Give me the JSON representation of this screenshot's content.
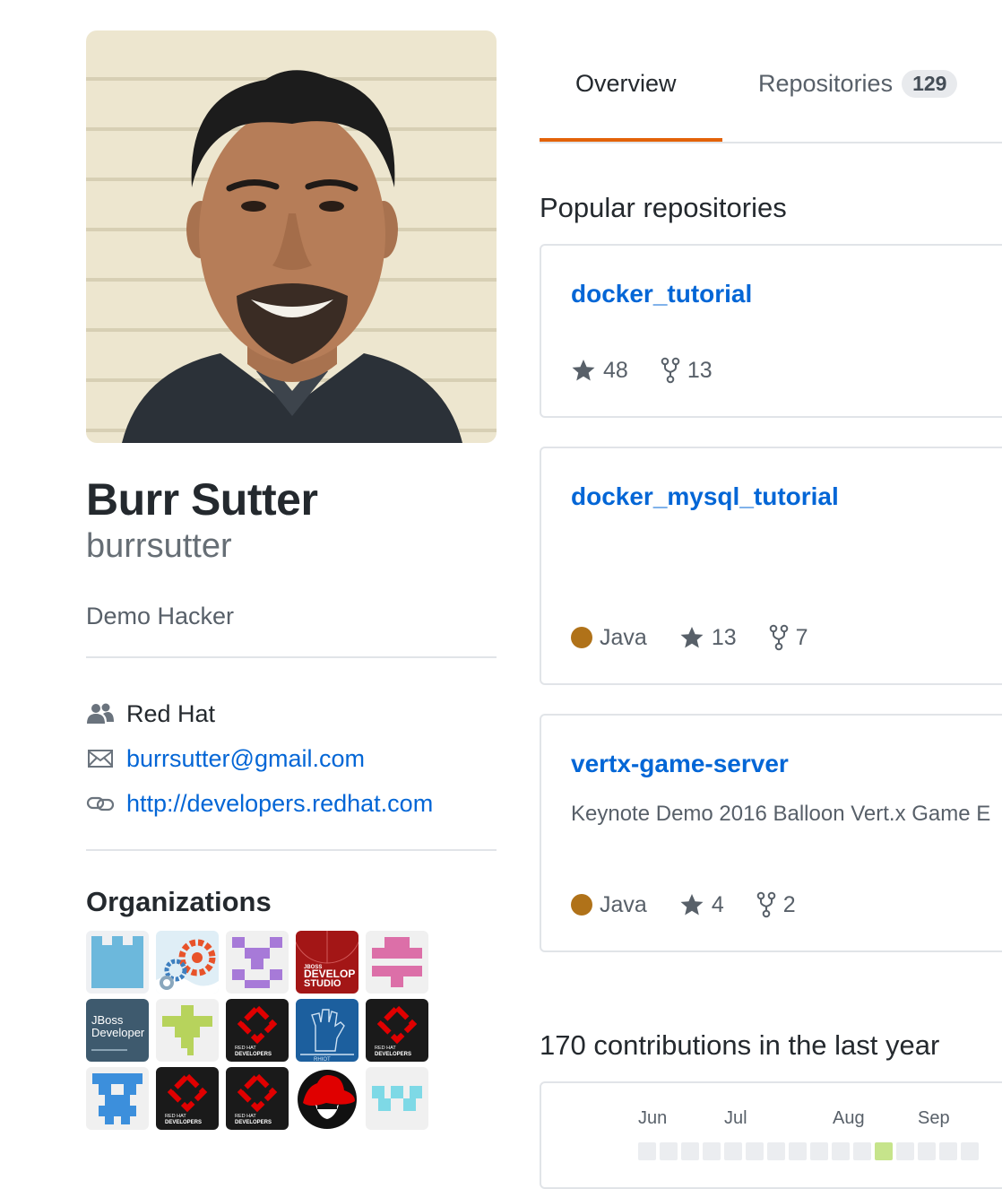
{
  "profile": {
    "full_name": "Burr Sutter",
    "login": "burrsutter",
    "bio": "Demo Hacker",
    "company": "Red Hat",
    "email": "burrsutter@gmail.com",
    "website": "http://developers.redhat.com"
  },
  "organizations": {
    "title": "Organizations",
    "items": [
      {
        "icon": "blue-castle-org-icon"
      },
      {
        "icon": "gears-org-icon"
      },
      {
        "icon": "purple-identicon-org-icon"
      },
      {
        "icon": "jboss-developer-studio-org-icon",
        "logo_text": [
          "JBOSS",
          "DEVELOP",
          "STUDIO"
        ]
      },
      {
        "icon": "pink-identicon-org-icon"
      },
      {
        "icon": "jboss-developer-org-icon",
        "logo_text": [
          "JBoss",
          "Developer"
        ]
      },
      {
        "icon": "green-identicon-org-icon"
      },
      {
        "icon": "red-hat-developers-org-icon",
        "logo_text": [
          "RED HAT",
          "DEVELOPERS"
        ]
      },
      {
        "icon": "rhiot-org-icon",
        "logo_text": [
          "RHIOT"
        ]
      },
      {
        "icon": "red-hat-developers-org-icon",
        "logo_text": [
          "RED HAT",
          "DEVELOPERS"
        ]
      },
      {
        "icon": "blue-identicon-org-icon"
      },
      {
        "icon": "red-hat-developers-org-icon",
        "logo_text": [
          "RED HAT",
          "DEVELOPERS"
        ]
      },
      {
        "icon": "red-hat-developers-org-icon",
        "logo_text": [
          "RED HAT",
          "DEVELOPERS"
        ]
      },
      {
        "icon": "red-hat-shadowman-org-icon"
      },
      {
        "icon": "cyan-identicon-org-icon"
      }
    ]
  },
  "tabs": [
    {
      "label": "Overview",
      "selected": true
    },
    {
      "label": "Repositories",
      "count": "129"
    }
  ],
  "popular": {
    "title": "Popular repositories",
    "repos": [
      {
        "name": "docker_tutorial",
        "description": "",
        "language": "",
        "stars": "48",
        "forks": "13"
      },
      {
        "name": "docker_mysql_tutorial",
        "description": "",
        "language": "Java",
        "stars": "13",
        "forks": "7"
      },
      {
        "name": "vertx-game-server",
        "description": "Keynote Demo 2016 Balloon Vert.x Game E",
        "language": "Java",
        "stars": "4",
        "forks": "2"
      }
    ]
  },
  "contributions": {
    "title": "170 contributions in the last year",
    "months": [
      "Jun",
      "Jul",
      "Aug",
      "Sep"
    ]
  },
  "colors": {
    "link": "#0366d6",
    "tab_accent": "#e36209",
    "java": "#b07219",
    "contribution_low": "#c6e48b",
    "contribution_none": "#ebedf0"
  }
}
